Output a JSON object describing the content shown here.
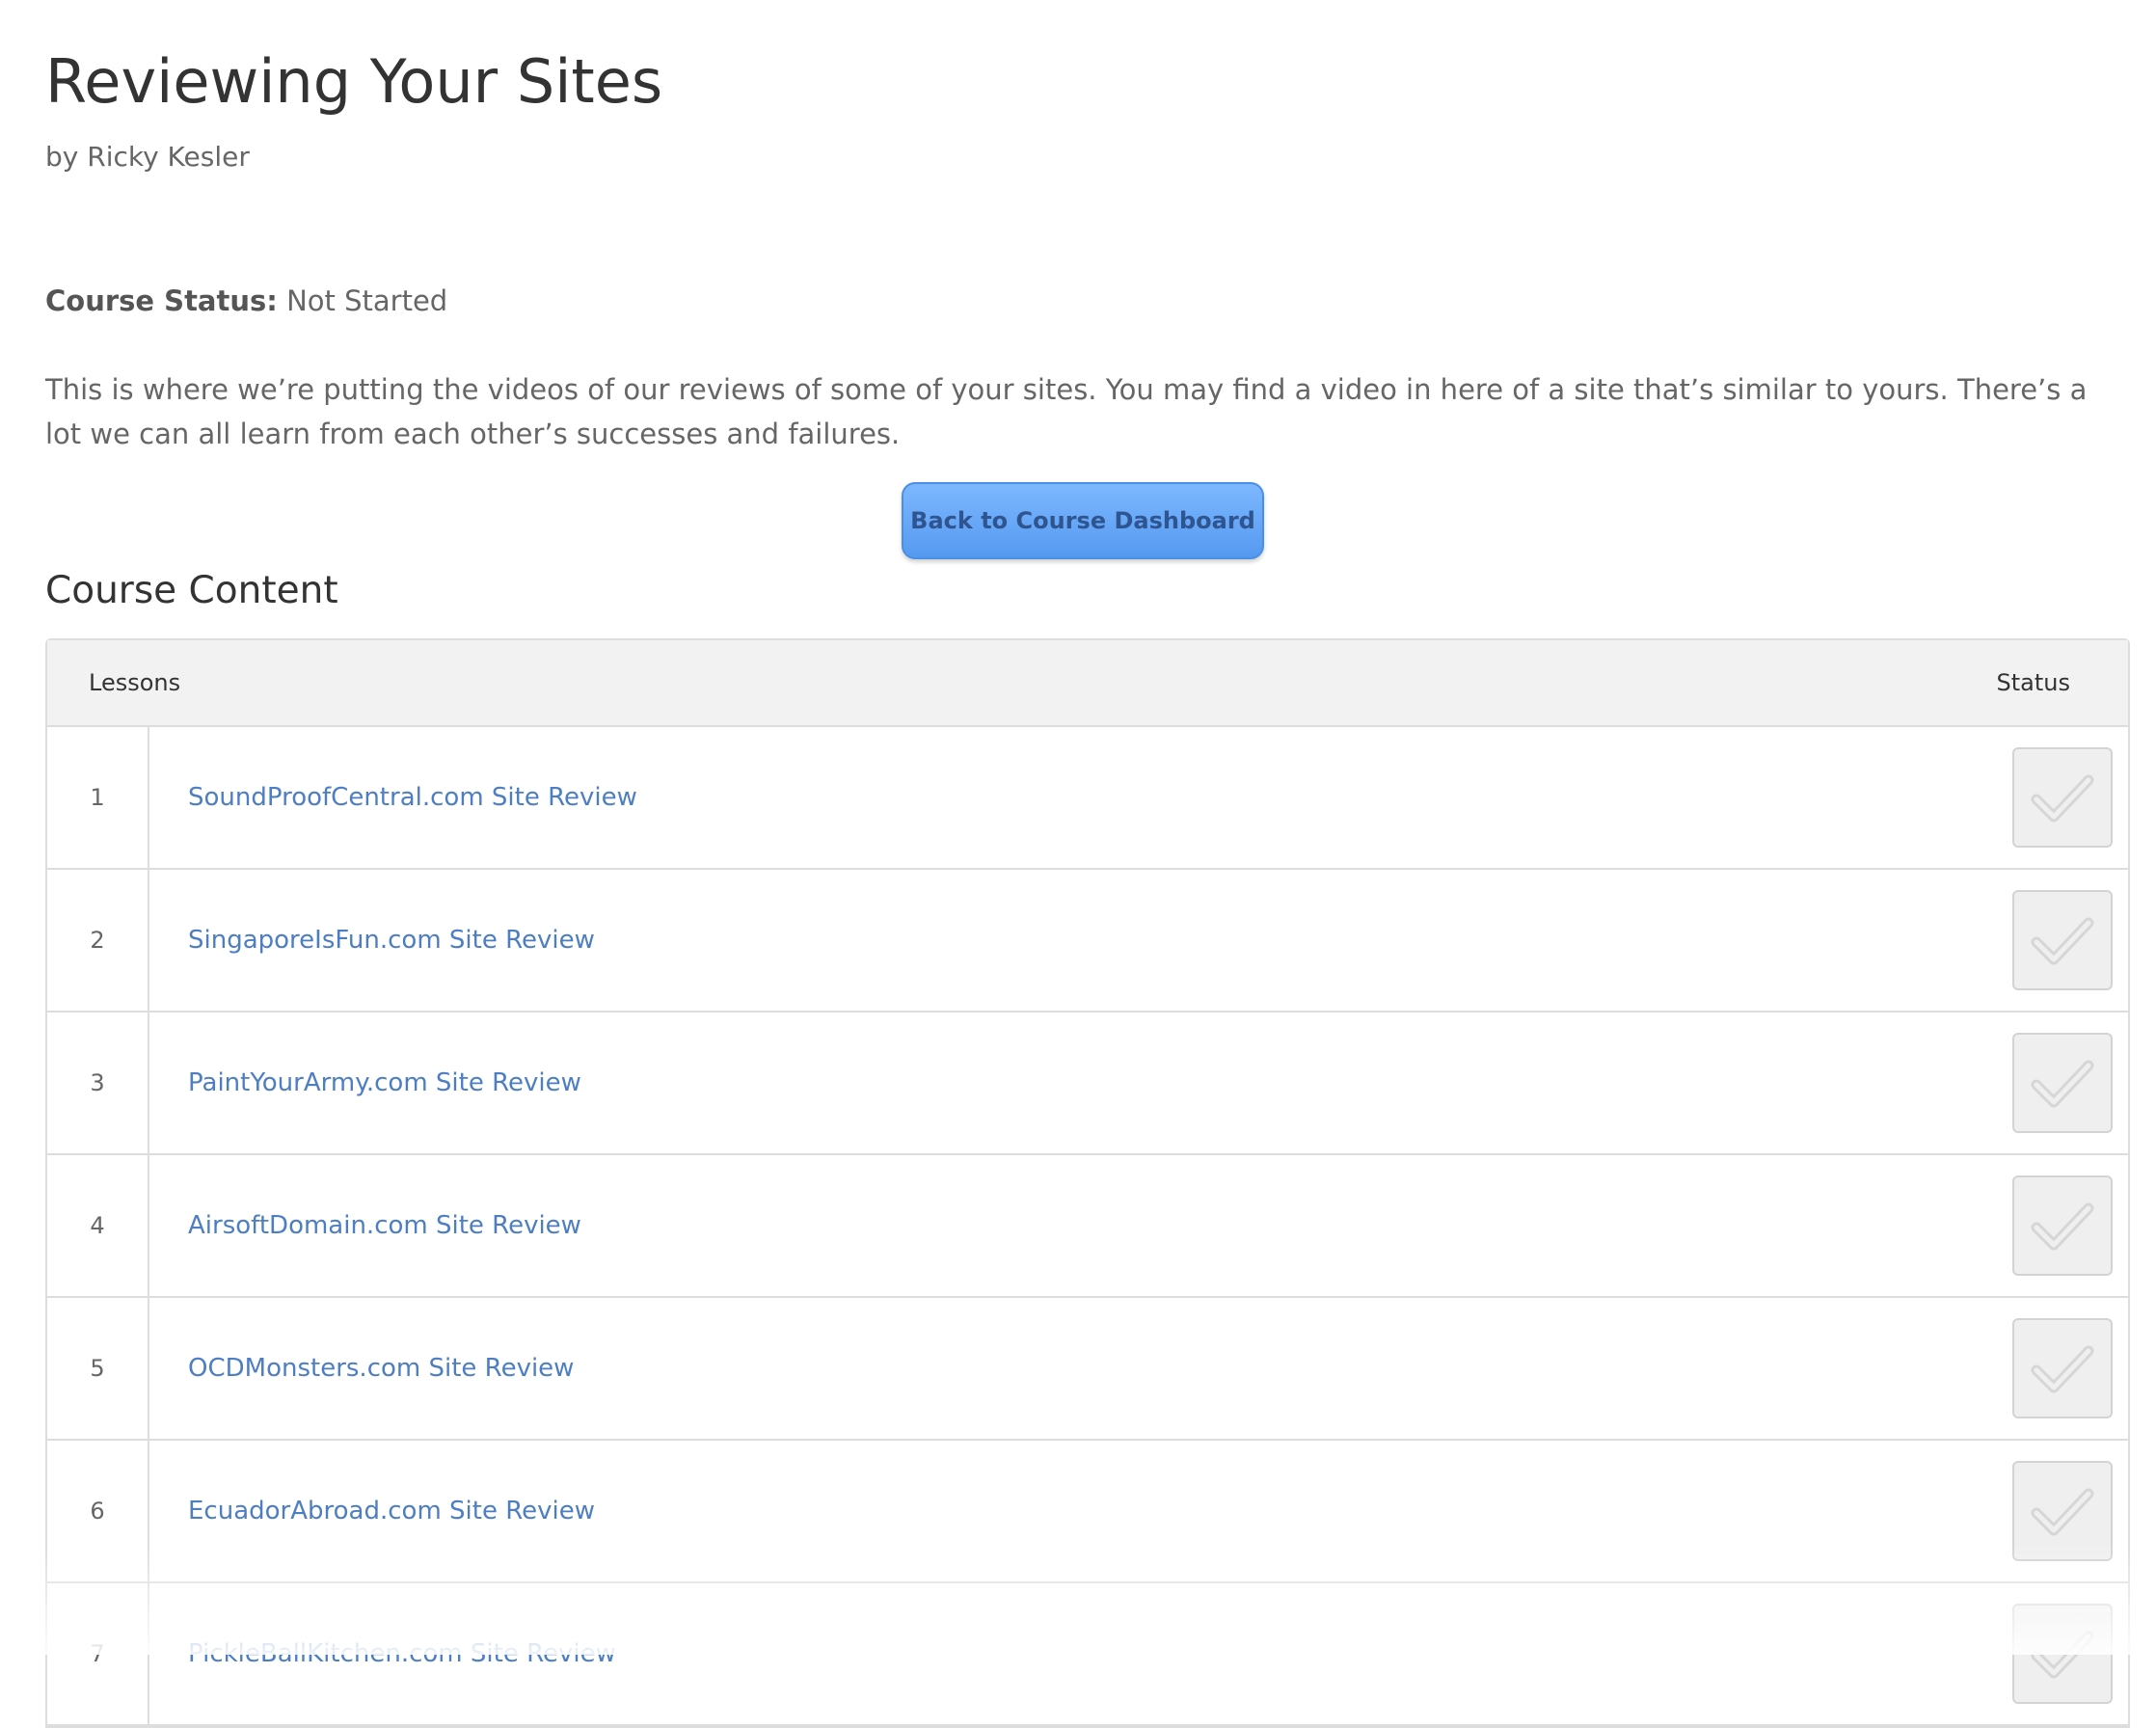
{
  "page": {
    "title": "Reviewing Your Sites",
    "byline": "by Ricky Kesler"
  },
  "course_status": {
    "label": "Course Status:",
    "value": "Not Started"
  },
  "description": "This is where we’re putting the videos of our reviews of some of your sites.  You may find a video in here of a site that’s similar to yours.  There’s a lot we can all learn from each other’s successes and failures.",
  "back_button": {
    "label": "Back to Course Dashboard"
  },
  "course_content": {
    "title": "Course Content",
    "headers": {
      "lessons": "Lessons",
      "status": "Status"
    },
    "lessons": [
      {
        "number": "1",
        "title": "SoundProofCentral.com Site Review"
      },
      {
        "number": "2",
        "title": "SingaporeIsFun.com Site Review"
      },
      {
        "number": "3",
        "title": "PaintYourArmy.com Site Review"
      },
      {
        "number": "4",
        "title": "AirsoftDomain.com Site Review"
      },
      {
        "number": "5",
        "title": "OCDMonsters.com Site Review"
      },
      {
        "number": "6",
        "title": "EcuadorAbroad.com Site Review"
      },
      {
        "number": "7",
        "title": "PickleBallKitchen.com Site Review"
      }
    ],
    "status_icon": "check-icon"
  },
  "colors": {
    "link": "#4d7ec3",
    "button": "#6aa8f8",
    "header_bg": "#f2f2f2"
  }
}
